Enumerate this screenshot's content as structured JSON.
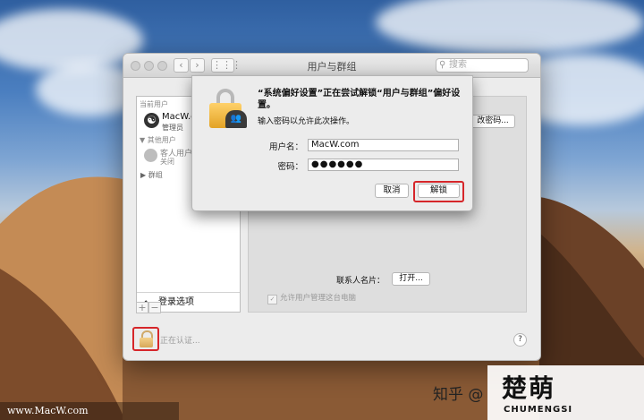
{
  "window": {
    "title": "用户与群组",
    "nav_back": "‹",
    "nav_forward": "›",
    "search_placeholder": "搜索"
  },
  "sidebar": {
    "current_users_header": "当前用户",
    "current_user": {
      "name": "MacW.co",
      "role": "管理员"
    },
    "other_users_header": "▼ 其他用户",
    "guest_user": {
      "name": "客人用户",
      "status": "关闭"
    },
    "groups_label": "▶ 群组",
    "login_options_label": "登录选项",
    "add_label": "+",
    "remove_label": "−"
  },
  "main": {
    "change_password_label": "改密码...",
    "contact_card_label": "联系人名片：",
    "open_button_label": "打开...",
    "allow_admin_label": "允许用户管理这台电脑",
    "auth_status": "正在认证...",
    "help_label": "?"
  },
  "dialog": {
    "message_title": "“系统偏好设置”正在尝试解锁“用户与群组”偏好设置。",
    "message_body": "输入密码以允许此次操作。",
    "username_label": "用户名：",
    "username_value": "MacW.com",
    "password_label": "密码：",
    "password_value": "●●●●●●",
    "cancel_label": "取消",
    "unlock_label": "解锁"
  },
  "watermarks": {
    "site": "www.MacW.com",
    "zhihu": "知乎 @",
    "brand_big": "楚萌",
    "brand_small": "CHUMENGSI"
  },
  "colors": {
    "highlight": "#d6262a",
    "lock_gold": "#e3a326"
  }
}
